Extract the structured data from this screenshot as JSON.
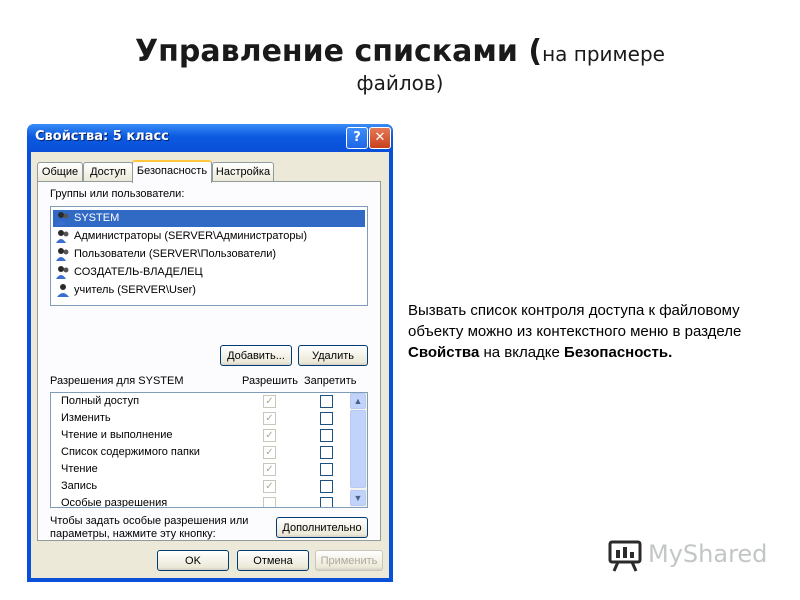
{
  "slide": {
    "title_main": "Управление списками (",
    "title_sub_1": "на примере",
    "title_sub_2": "файлов)",
    "description_1": "Вызвать список контроля доступа к файловому объекту можно из контекстного меню в разделе ",
    "description_bold_1": "Свойства",
    "description_2": " на вкладке ",
    "description_bold_2": "Безопасность."
  },
  "window": {
    "title": "Свойства: 5 класс",
    "help_label": "?",
    "close_label": "✕",
    "tabs": [
      "Общие",
      "Доступ",
      "Безопасность",
      "Настройка"
    ],
    "active_tab": "Безопасность",
    "groups_label": "Группы или пользователи:",
    "users": [
      "SYSTEM",
      "Администраторы (SERVER\\Администраторы)",
      "Пользователи (SERVER\\Пользователи)",
      "СОЗДАТЕЛЬ-ВЛАДЕЛЕЦ",
      "учитель (SERVER\\User)"
    ],
    "selected_user": "SYSTEM",
    "add_button": "Добавить...",
    "remove_button": "Удалить",
    "permissions_label": "Разрешения для SYSTEM",
    "allow_header": "Разрешить",
    "deny_header": "Запретить",
    "permissions": [
      {
        "name": "Полный доступ",
        "allow": true,
        "deny": false
      },
      {
        "name": "Изменить",
        "allow": true,
        "deny": false
      },
      {
        "name": "Чтение и выполнение",
        "allow": true,
        "deny": false
      },
      {
        "name": "Список содержимого папки",
        "allow": true,
        "deny": false
      },
      {
        "name": "Чтение",
        "allow": true,
        "deny": false
      },
      {
        "name": "Запись",
        "allow": true,
        "deny": false
      },
      {
        "name": "Особые разрешения",
        "allow": false,
        "deny": false
      }
    ],
    "special_hint": "Чтобы задать особые разрешения или параметры, нажмите эту кнопку:",
    "advanced_button": "Дополнительно",
    "ok_button": "OK",
    "cancel_button": "Отмена",
    "apply_button": "Применить"
  },
  "logo": {
    "text": "MyShared"
  },
  "colors": {
    "titlebar": "#0a4fd8",
    "selection": "#316ac5",
    "dialog_bg": "#ece9d8"
  }
}
